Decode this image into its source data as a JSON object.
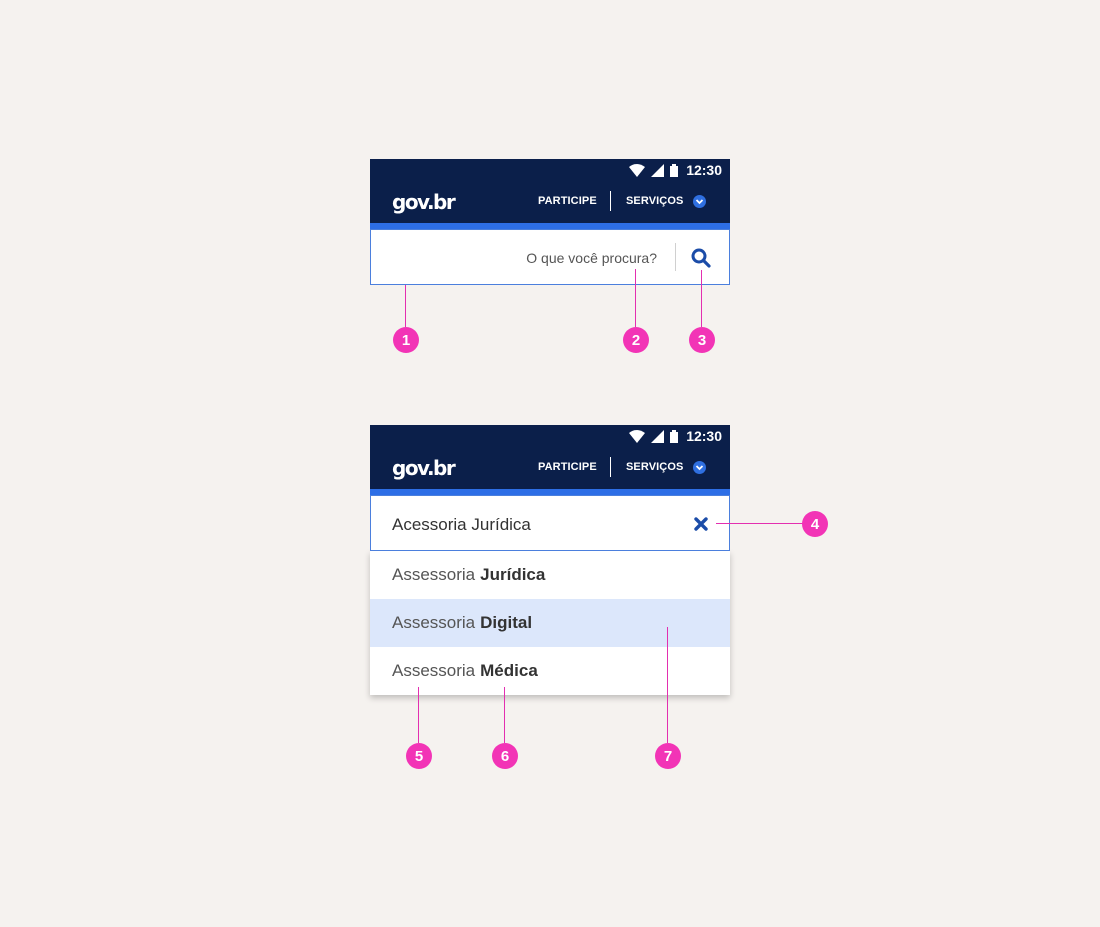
{
  "mockups": [
    {
      "status": {
        "time": "12:30"
      },
      "header": {
        "logo": "gov.br",
        "nav_participe": "PARTICIPE",
        "nav_servicos": "SERVIÇOS"
      },
      "search": {
        "placeholder": "O que você procura?"
      }
    },
    {
      "status": {
        "time": "12:30"
      },
      "header": {
        "logo": "gov.br",
        "nav_participe": "PARTICIPE",
        "nav_servicos": "SERVIÇOS"
      },
      "search": {
        "query": "Acessoria Jurídica"
      },
      "suggestions": [
        {
          "normal": "Assessoria",
          "bold": "Jurídica",
          "active": false
        },
        {
          "normal": "Assessoria",
          "bold": "Digital",
          "active": true
        },
        {
          "normal": "Assessoria",
          "bold": "Médica",
          "active": false
        }
      ]
    }
  ],
  "callouts": [
    "1",
    "2",
    "3",
    "4",
    "5",
    "6",
    "7"
  ],
  "colors": {
    "header_bg": "#0b1f4a",
    "accent_blue": "#2d6ee6",
    "highlight_row": "#dce7fb",
    "callout_pink": "#f234b6",
    "icon_blue": "#1b4ca8"
  },
  "icons": [
    "wifi-icon",
    "signal-icon",
    "battery-icon",
    "chevron-down-icon",
    "search-icon",
    "close-icon"
  ]
}
